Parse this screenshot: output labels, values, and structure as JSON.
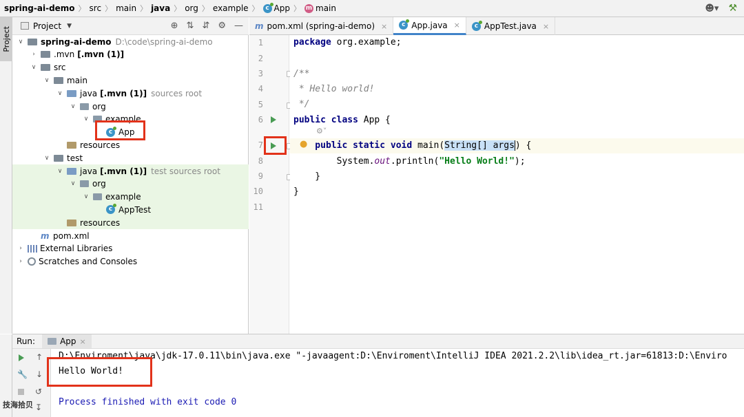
{
  "breadcrumb": [
    {
      "label": "spring-ai-demo",
      "bold": true
    },
    {
      "label": "src"
    },
    {
      "label": "main"
    },
    {
      "label": "java",
      "bold": true
    },
    {
      "label": "org"
    },
    {
      "label": "example"
    },
    {
      "label": "App",
      "icon": "class-icon"
    },
    {
      "label": "main",
      "icon": "method-icon"
    }
  ],
  "side_stripe": {
    "project_label": "Project"
  },
  "project_panel": {
    "title": "Project",
    "tree": [
      {
        "label": "spring-ai-demo",
        "bold": true,
        "suffix": "D:\\code\\spring-ai-demo",
        "indent": 0,
        "arrow": "down",
        "icon": "folder"
      },
      {
        "label": ".mvn",
        "bold_suffix": "[.mvn (1)]",
        "indent": 1,
        "arrow": "right",
        "icon": "folder"
      },
      {
        "label": "src",
        "indent": 1,
        "arrow": "down",
        "icon": "folder"
      },
      {
        "label": "main",
        "indent": 2,
        "arrow": "down",
        "icon": "folder"
      },
      {
        "label": "java",
        "bold_suffix": "[.mvn (1)]",
        "suffix": "sources root",
        "indent": 3,
        "arrow": "down",
        "icon": "source-folder"
      },
      {
        "label": "org",
        "indent": 4,
        "arrow": "down",
        "icon": "package"
      },
      {
        "label": "example",
        "indent": 5,
        "arrow": "down",
        "icon": "package"
      },
      {
        "label": "App",
        "indent": 6,
        "arrow": "",
        "icon": "class"
      },
      {
        "label": "resources",
        "indent": 3,
        "arrow": "",
        "icon": "resources-folder"
      },
      {
        "label": "test",
        "indent": 2,
        "arrow": "down",
        "icon": "folder"
      },
      {
        "label": "java",
        "bold_suffix": "[.mvn (1)]",
        "suffix": "test sources root",
        "indent": 3,
        "arrow": "down",
        "icon": "test-folder",
        "green": true
      },
      {
        "label": "org",
        "indent": 4,
        "arrow": "down",
        "icon": "package",
        "green": true
      },
      {
        "label": "example",
        "indent": 5,
        "arrow": "down",
        "icon": "package",
        "green": true
      },
      {
        "label": "AppTest",
        "indent": 6,
        "arrow": "",
        "icon": "class",
        "green": true
      },
      {
        "label": "resources",
        "indent": 3,
        "arrow": "",
        "icon": "resources-folder",
        "green": true
      },
      {
        "label": "pom.xml",
        "indent": 1,
        "arrow": "",
        "icon": "pom"
      },
      {
        "label": "External Libraries",
        "indent": 0,
        "arrow": "right",
        "icon": "library"
      },
      {
        "label": "Scratches and Consoles",
        "indent": 0,
        "arrow": "right",
        "icon": "scratches"
      }
    ]
  },
  "editor": {
    "tabs": [
      {
        "label": "pom.xml (spring-ai-demo)",
        "icon": "m",
        "active": false
      },
      {
        "label": "App.java",
        "icon": "c",
        "active": true
      },
      {
        "label": "AppTest.java",
        "icon": "c",
        "active": false
      }
    ],
    "line_numbers": [
      "1",
      "2",
      "3",
      "4",
      "5",
      "6",
      "7",
      "8",
      "9",
      "10",
      "11"
    ],
    "code": {
      "l1a": "package ",
      "l1b": "org.example;",
      "l3": "/**",
      "l4": " * Hello world!",
      "l5": " */",
      "l6a": "public class ",
      "l6b": "App {",
      "l7a": "    public static void ",
      "l7b": "main(",
      "l7c": "String[] args",
      "l7d": ") {",
      "l8a": "        System.",
      "l8b": "out",
      "l8c": ".println(",
      "l8d": "\"Hello World!\"",
      "l8e": ");",
      "l9": "    }",
      "l10": "}"
    }
  },
  "run_panel": {
    "label": "Run:",
    "tab": "App",
    "console": {
      "cmd": "D:\\Enviroment\\java\\jdk-17.0.11\\bin\\java.exe",
      "args": " \"-javaagent:D:\\Enviroment\\IntelliJ IDEA 2021.2.2\\lib\\idea_rt.jar=61813:D:\\Enviro",
      "output": "Hello World!",
      "finish": "Process finished with exit code 0"
    }
  },
  "watermark": "技海拾贝",
  "colors": {
    "highlight": "#e2321a",
    "run_green": "#499c54",
    "keyword": "#000080",
    "string": "#067d17"
  }
}
